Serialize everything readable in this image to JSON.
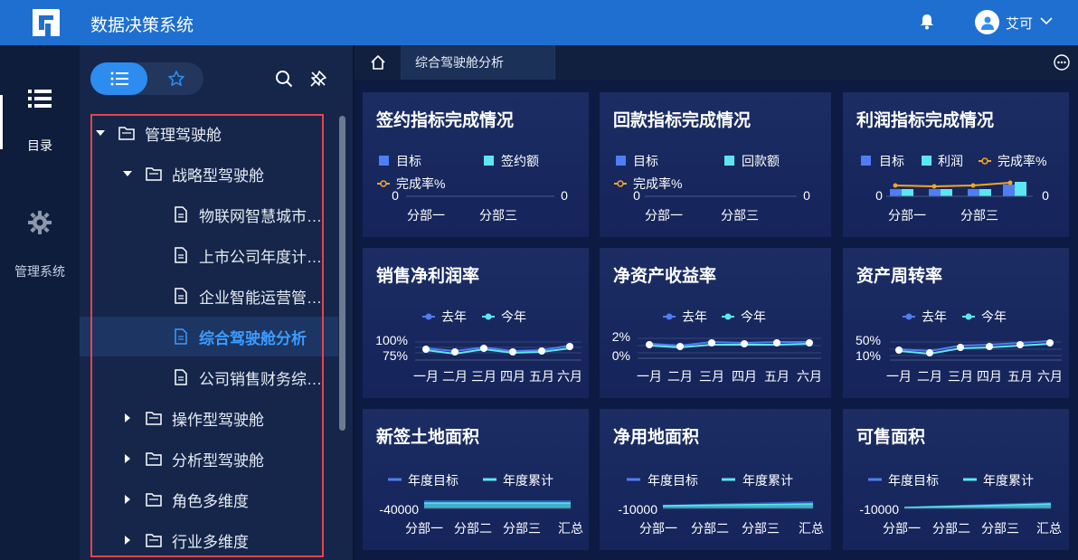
{
  "app": {
    "title": "数据决策系统",
    "username": "艾可"
  },
  "leftnav": {
    "catalog": "目录",
    "admin": "管理系统"
  },
  "tree": {
    "root": "管理驾驶舱",
    "strategy": "战略型驾驶舱",
    "doc1": "物联网智慧城市…",
    "doc2": "上市公司年度计…",
    "doc3": "企业智能运营管…",
    "doc4": "综合驾驶舱分析",
    "doc5": "公司销售财务综…",
    "op": "操作型驾驶舱",
    "analysis": "分析型驾驶舱",
    "role": "角色多维度",
    "industry": "行业多维度"
  },
  "tabs": {
    "active": "综合驾驶舱分析"
  },
  "cards": {
    "c1": {
      "title": "签约指标完成情况",
      "leg1": "目标",
      "leg2": "签约额",
      "leg3": "完成率%",
      "yl": "0",
      "yr": "0",
      "x1": "分部一",
      "x2": "分部三"
    },
    "c2": {
      "title": "回款指标完成情况",
      "leg1": "目标",
      "leg2": "回款额",
      "leg3": "完成率%",
      "yl": "0",
      "yr": "0",
      "x1": "分部一",
      "x2": "分部三"
    },
    "c3": {
      "title": "利润指标完成情况",
      "leg1": "目标",
      "leg2": "利润",
      "leg3": "完成率%",
      "yl": "0",
      "yr": "0",
      "x1": "分部一",
      "x2": "分部三"
    },
    "c4": {
      "title": "销售净利润率",
      "leg1": "去年",
      "leg2": "今年",
      "y1": "100%",
      "y2": "75%"
    },
    "c5": {
      "title": "净资产收益率",
      "leg1": "去年",
      "leg2": "今年",
      "y1": "2%",
      "y2": "0%"
    },
    "c6": {
      "title": "资产周转率",
      "leg1": "去年",
      "leg2": "今年",
      "y1": "50%",
      "y2": "10%"
    },
    "c7": {
      "title": "新签土地面积",
      "leg1": "年度目标",
      "leg2": "年度累计",
      "y1": "-40000"
    },
    "c8": {
      "title": "净用地面积",
      "leg1": "年度目标",
      "leg2": "年度累计",
      "y1": "-10000"
    },
    "c9": {
      "title": "可售面积",
      "leg1": "年度目标",
      "leg2": "年度累计",
      "y1": "-10000"
    }
  },
  "months": [
    "一月",
    "二月",
    "三月",
    "四月",
    "五月",
    "六月"
  ],
  "divisions": [
    "分部一",
    "分部二",
    "分部三",
    "汇总"
  ],
  "colors": {
    "topbar": "#1e6fd0",
    "accent": "#2d8cf0",
    "series_blue": "#4f7df5",
    "series_cyan": "#5ee6f0",
    "rate": "#f5a623",
    "outline": "#e8434c"
  }
}
